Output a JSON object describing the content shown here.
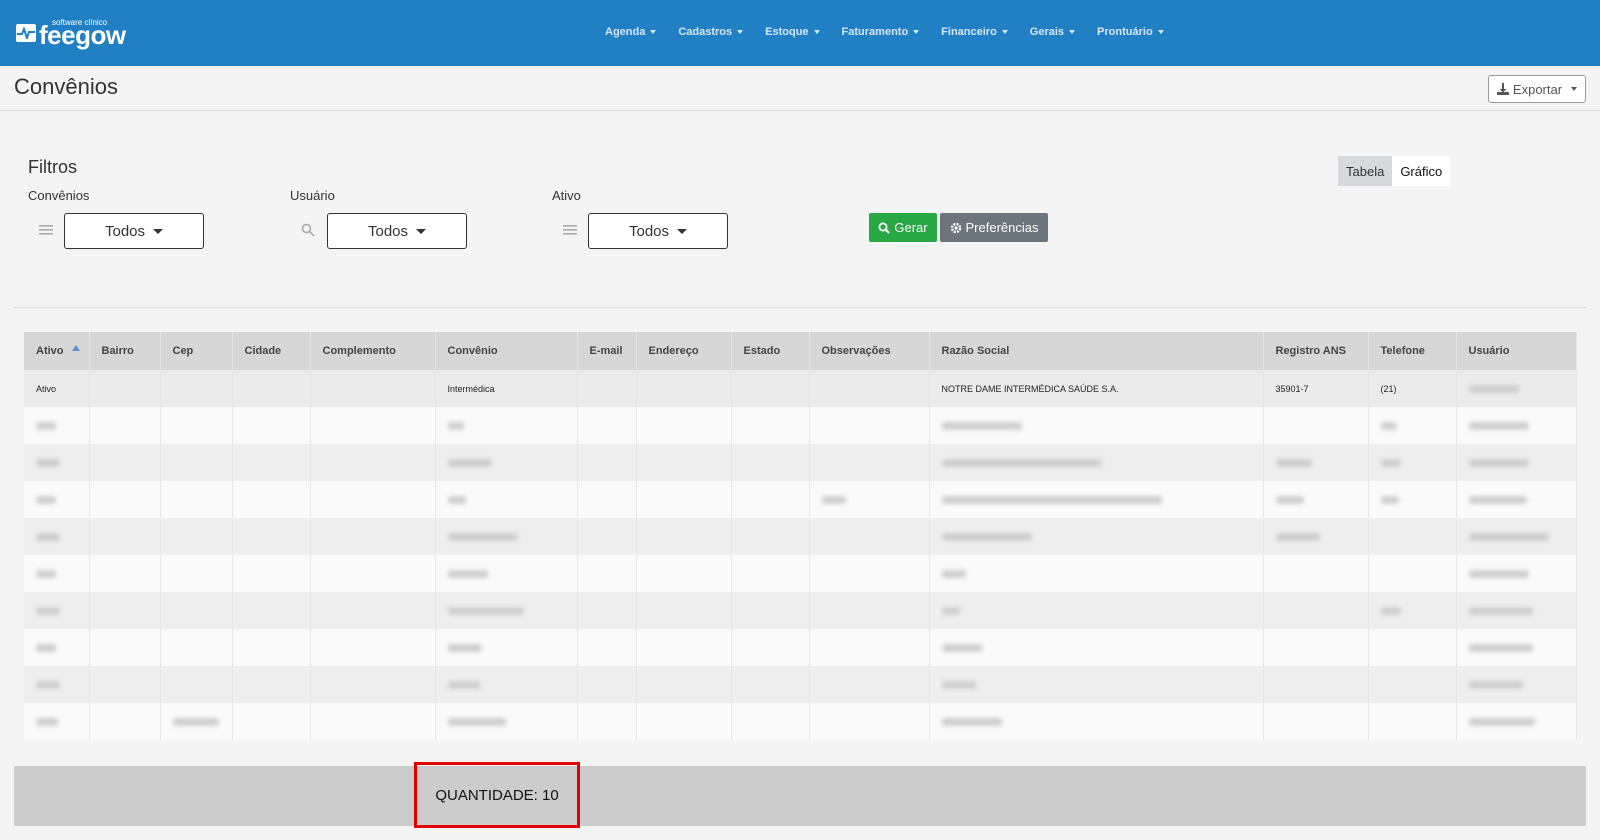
{
  "header": {
    "logo_subtitle": "software clínico",
    "logo_text": "feegow",
    "nav": [
      {
        "label": "Agenda"
      },
      {
        "label": "Cadastros"
      },
      {
        "label": "Estoque"
      },
      {
        "label": "Faturamento"
      },
      {
        "label": "Financeiro"
      },
      {
        "label": "Gerais"
      },
      {
        "label": "Prontuário"
      }
    ]
  },
  "page": {
    "title": "Convênios",
    "export_label": "Exportar"
  },
  "filters": {
    "title": "Filtros",
    "convenios": {
      "label": "Convênios",
      "value": "Todos"
    },
    "usuario": {
      "label": "Usuário",
      "value": "Todos"
    },
    "ativo": {
      "label": "Ativo",
      "value": "Todos"
    },
    "gerar_label": "Gerar",
    "preferencias_label": "Preferências"
  },
  "view_toggle": {
    "tabela": "Tabela",
    "grafico": "Gráfico"
  },
  "table": {
    "columns": [
      "Ativo",
      "Bairro",
      "Cep",
      "Cidade",
      "Complemento",
      "Convênio",
      "E-mail",
      "Endereço",
      "Estado",
      "Observações",
      "Razão Social",
      "Registro ANS",
      "Telefone",
      "Usuário"
    ],
    "first_row": {
      "ativo": "Ativo",
      "convenio": "Intermédica",
      "razao_social": "NOTRE DAME INTERMÉDICA SAÚDE S.A.",
      "registro_ans": "35901-7",
      "telefone": "(21)"
    }
  },
  "footer": {
    "quantidade": "QUANTIDADE: 10"
  },
  "colors": {
    "topbar": "#2180c4",
    "gerar": "#28a745",
    "preferencias": "#6c757d",
    "highlight": "#e00000"
  }
}
